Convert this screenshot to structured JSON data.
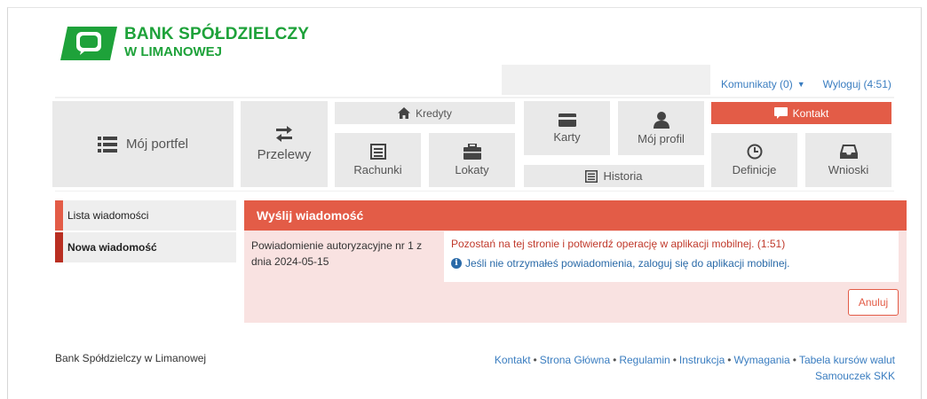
{
  "brand": {
    "line1": "BANK SPÓŁDZIELCZY",
    "line2": "W LIMANOWEJ",
    "color": "#1ea23a"
  },
  "topbar": {
    "messages_label": "Komunikaty (0)",
    "logout_label": "Wyloguj (4:51)"
  },
  "nav": {
    "portfel": "Mój portfel",
    "przelewy": "Przelewy",
    "kredyty": "Kredyty",
    "rachunki": "Rachunki",
    "lokaty": "Lokaty",
    "karty": "Karty",
    "profil": "Mój profil",
    "historia": "Historia",
    "kontakt": "Kontakt",
    "definicje": "Definicje",
    "wnioski": "Wnioski"
  },
  "sidebar": {
    "items": [
      {
        "label": "Lista wiadomości"
      },
      {
        "label": "Nowa wiadomość"
      }
    ]
  },
  "panel": {
    "title": "Wyślij wiadomość",
    "subject_line1": "Powiadomienie autoryzacyjne nr 1 z",
    "subject_line2": "dnia 2024-05-15",
    "notice": "Pozostań na tej stronie i potwierdź operację w aplikacji mobilnej. (1:51)",
    "info": "Jeśli nie otrzymałeś powiadomienia, zaloguj się do aplikacji mobilnej.",
    "cancel_label": "Anuluj"
  },
  "footer": {
    "bank_name": "Bank Spółdzielczy w Limanowej",
    "links": [
      "Kontakt",
      "Strona Główna",
      "Regulamin",
      "Instrukcja",
      "Wymagania",
      "Tabela kursów walut"
    ],
    "link_extra": "Samouczek SKK"
  },
  "colors": {
    "accent": "#e35c47",
    "accent_dark": "#b92f22",
    "link": "#3a7dc0",
    "tile": "#e9e9e9",
    "panel_bg": "#f9e2e1"
  }
}
